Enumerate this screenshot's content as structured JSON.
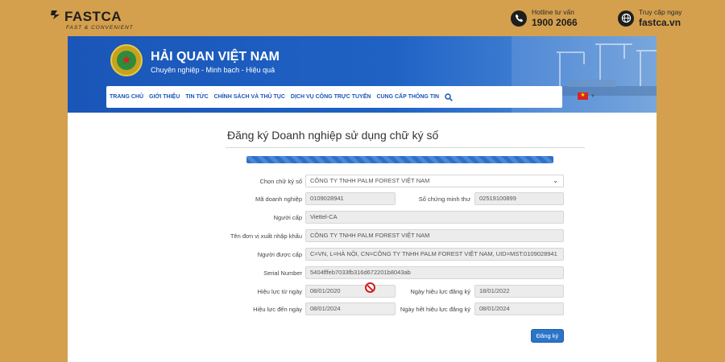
{
  "brand": {
    "name": "FASTCA",
    "tagline": "FAST & CONVENIENT"
  },
  "contact": {
    "hotline_label": "Hotline tư vấn",
    "hotline_value": "1900 2066",
    "access_label": "Truy cập ngay",
    "access_value": "fastca.vn"
  },
  "site": {
    "name": "HẢI QUAN VIỆT NAM",
    "motto": "Chuyên nghiệp - Minh bạch - Hiệu quả",
    "nav": [
      "TRANG CHỦ",
      "GIỚI THIỆU",
      "TIN TỨC",
      "CHÍNH SÁCH VÀ THỦ TỤC",
      "DỊCH VỤ CÔNG TRỰC TUYẾN",
      "CUNG CẤP THÔNG TIN"
    ]
  },
  "form": {
    "title": "Đăng ký Doanh nghiệp sử dụng chữ ký số",
    "labels": {
      "signature": "Chọn chữ ký số",
      "tax_code": "Mã doanh nghiệp",
      "id_number": "Số chứng minh thư",
      "issuer": "Người cấp",
      "importer_name": "Tên đơn vị xuất nhập khẩu",
      "subject": "Người được cấp",
      "serial": "Serial Number",
      "valid_from": "Hiệu lực từ ngày",
      "reg_valid_from": "Ngày hiệu lực đăng ký",
      "valid_to": "Hiệu lực đến ngày",
      "reg_valid_to": "Ngày hết hiệu lực đăng ký"
    },
    "values": {
      "signature": "CÔNG TY TNHH PALM FOREST VIỆT NAM",
      "tax_code": "0109028941",
      "id_number": "02519100899",
      "issuer": "Viettel-CA",
      "importer_name": "CÔNG TY TNHH PALM FOREST VIỆT NAM",
      "subject": "C=VN, L=HÀ NỘI, CN=CÔNG TY TNHH PALM FOREST VIỆT NAM, UID=MST:0109028941",
      "serial": "5404fffeb7033fb316d672201b8043ab",
      "valid_from": "08/01/2020",
      "reg_valid_from": "18/01/2022",
      "valid_to": "08/01/2024",
      "reg_valid_to": "08/01/2024"
    },
    "submit_label": "Đăng ký"
  },
  "colors": {
    "background": "#d4a04e",
    "banner": "#1a56b8",
    "nav_text": "#1a56b8",
    "button": "#2c74c9"
  }
}
